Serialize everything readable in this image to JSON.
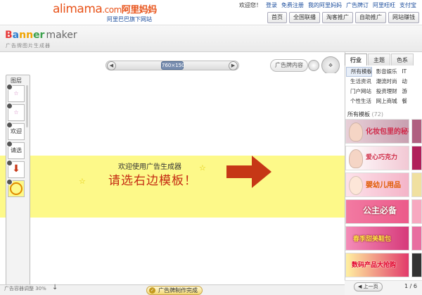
{
  "header": {
    "logo_text": "alimama",
    "logo_dotcom": ".com",
    "logo_cn": "阿里妈妈",
    "logo_sub": "阿里巴巴旗下网站",
    "top_links": [
      "欢迎您！",
      "登录",
      "免费注册",
      "我的阿里妈妈",
      "广告牌订",
      "阿里旺旺",
      "支付宝"
    ],
    "nav_buttons": [
      "首页",
      "全国联播",
      "淘客推广",
      "自助推广",
      "网站赚钱"
    ]
  },
  "maker": {
    "logo_letters": [
      "B",
      "a",
      "nn",
      "er"
    ],
    "logo_maker": "maker",
    "logo_sub": "广告牌图片生成器"
  },
  "toolbar": {
    "size_value": "760×150",
    "content_button": "广告牌内容"
  },
  "layers": {
    "title": "图层",
    "items": [
      "",
      "",
      "欢迎",
      "请选",
      "",
      ""
    ]
  },
  "banner": {
    "line1": "欢迎使用广告生成器",
    "line2": "请选右边模板！"
  },
  "bottom": {
    "zoom_text": "广告容器调整 30%",
    "done_button": "广告牌制作完成"
  },
  "sidebar": {
    "tabs": [
      "行业",
      "主题",
      "色系"
    ],
    "categories": [
      [
        "所有模板",
        "影音娱乐",
        "IT"
      ],
      [
        "生活资讯",
        "潮流时尚",
        "动"
      ],
      [
        "门户网站",
        "投资理财",
        "游"
      ],
      [
        "个性生活",
        "网上商城",
        "餐"
      ]
    ],
    "all_templates_label": "所有模板",
    "all_templates_count": "(72)",
    "thumbnails": [
      {
        "title": "化妆包里的秘密",
        "color": "#c8a0b0"
      },
      {
        "title": "爱心巧克力",
        "color": "#e8b8c8"
      },
      {
        "title": "婴幼儿用品",
        "color": "#f4b4c8"
      },
      {
        "title": "公主必备",
        "color": "#ec5a8a"
      },
      {
        "title": "春季甜美鞋包",
        "color": "#d63a7a"
      },
      {
        "title": "数码产品大抢购",
        "color": "#e23a6a"
      }
    ],
    "prev_button": "上一页",
    "page_number": "1 / 6"
  },
  "colors": {
    "brand_orange": "#e8531a",
    "banner_yellow": "#fdf989",
    "arrow_red": "#c63716"
  }
}
